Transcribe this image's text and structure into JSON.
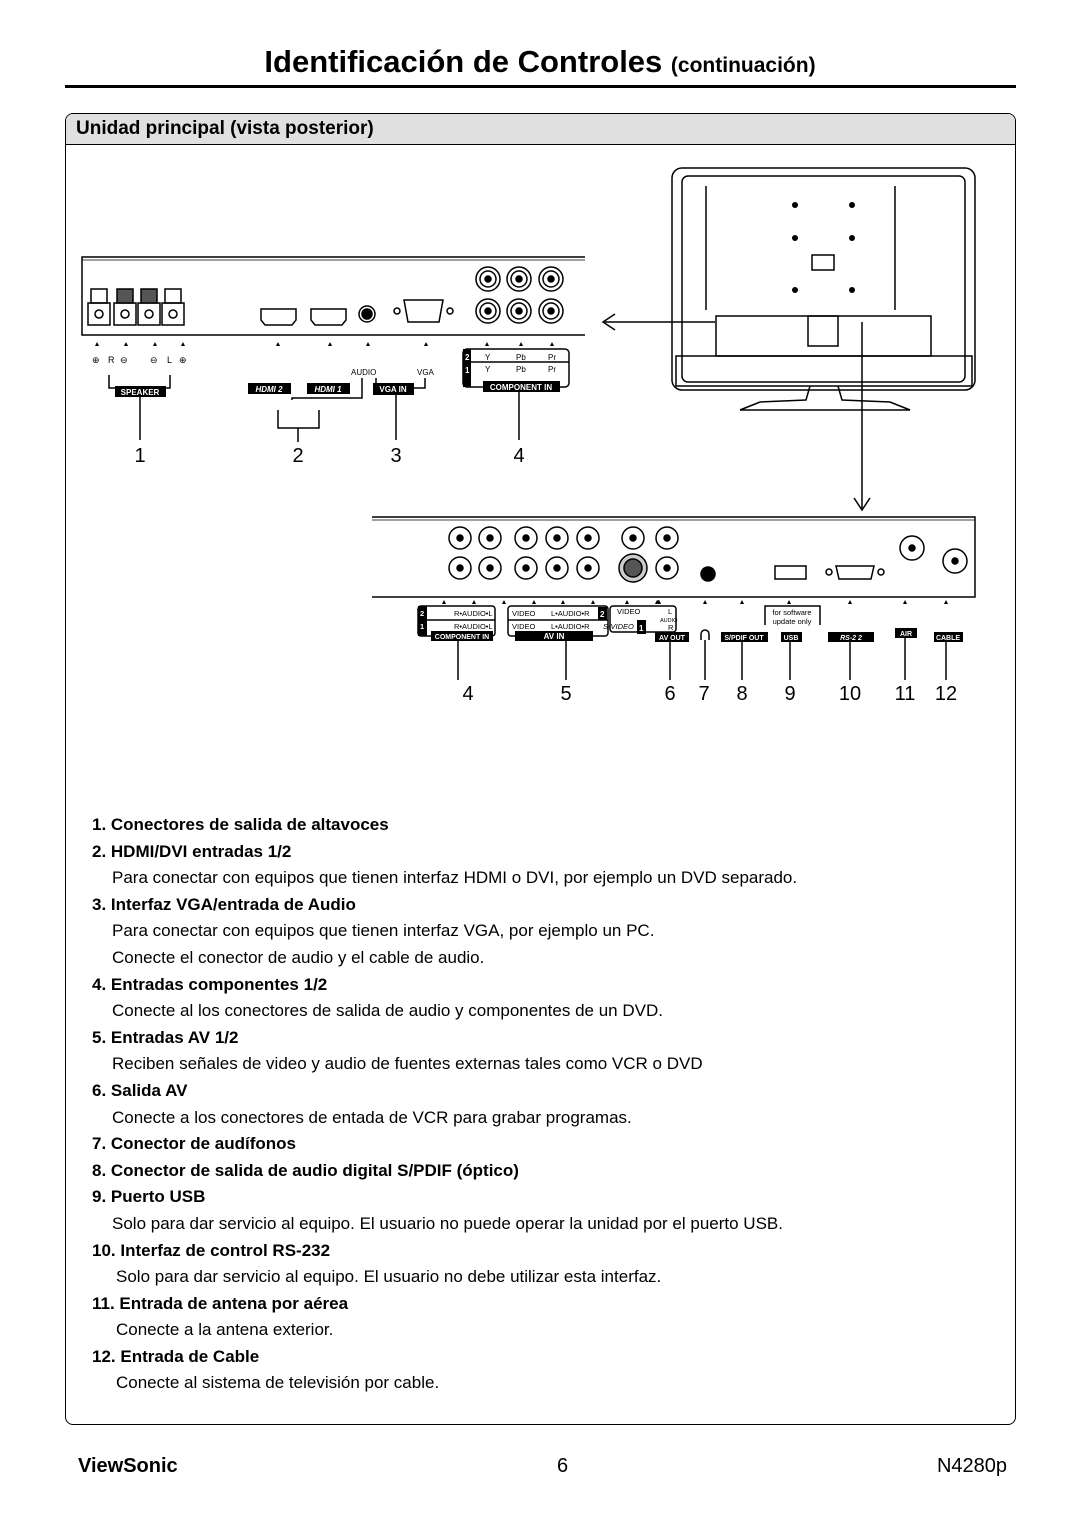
{
  "title": {
    "main": "Identificación de Controles",
    "sub": "(continuación)"
  },
  "section": {
    "heading": "Unidad principal (vista posterior)"
  },
  "diagram_top": {
    "speaker_marks": [
      "⊕",
      "R",
      "⊖",
      "⊖",
      "L",
      "⊕"
    ],
    "speaker_label": "SPEAKER",
    "hdmi2_label": "HDMI 2",
    "hdmi1_label": "HDMI 1",
    "audio_label": "AUDIO",
    "vga_label": "VGA",
    "vga_in_label": "VGA IN",
    "component_rows": [
      {
        "num": "2",
        "y": "Y",
        "pb": "Pb",
        "pr": "Pr"
      },
      {
        "num": "1",
        "y": "Y",
        "pb": "Pb",
        "pr": "Pr"
      }
    ],
    "component_label": "COMPONENT IN",
    "numbers": [
      "1",
      "2",
      "3",
      "4"
    ]
  },
  "diagram_bottom": {
    "component_rows": [
      {
        "num": "2",
        "text": "R•AUDIO•L"
      },
      {
        "num": "1",
        "text": "R•AUDIO•L"
      }
    ],
    "component_label": "COMPONENT IN",
    "av_rows": [
      {
        "video": "VIDEO",
        "audio": "L•AUDIO•R",
        "num": "2"
      },
      {
        "video": "VIDEO",
        "audio": "L•AUDIO•R",
        "svideo": "S-VIDEO",
        "num": "1"
      }
    ],
    "av_in_label": "AV  IN",
    "av_out_video": "VIDEO",
    "av_out_l": "L",
    "av_out_audio": "AUDIO",
    "av_out_r": "R",
    "av_out_label": "AV OUT",
    "spdif_label": "S/PDIF OUT",
    "usb_note": [
      "for software",
      "update only"
    ],
    "usb_label": "USB",
    "rs232_label": "RS-2 2",
    "air_label": "AIR",
    "cable_label": "CABLE",
    "numbers": [
      "4",
      "5",
      "6",
      "7",
      "8",
      "9",
      "10",
      "11",
      "12"
    ]
  },
  "items": [
    {
      "heading": "1. Conectores de salida de altavoces",
      "desc": []
    },
    {
      "heading": "2. HDMI/DVI entradas 1/2",
      "desc": [
        "Para conectar con equipos que tienen interfaz HDMI o DVI, por ejemplo un DVD separado."
      ]
    },
    {
      "heading": "3. Interfaz VGA/entrada de Audio",
      "desc": [
        "Para conectar con equipos que tienen interfaz VGA, por ejemplo un PC.",
        "Conecte el conector de audio y el cable de audio."
      ]
    },
    {
      "heading": "4. Entradas componentes 1/2",
      "desc": [
        "Conecte al los conectores de salida de audio y componentes de un DVD."
      ]
    },
    {
      "heading": "5. Entradas AV 1/2",
      "desc": [
        "Reciben señales de video y audio de fuentes externas tales como VCR o DVD"
      ]
    },
    {
      "heading": "6. Salida AV",
      "desc": [
        "Conecte a los conectores de entada de VCR para grabar programas."
      ]
    },
    {
      "heading": "7. Conector de audífonos",
      "desc": []
    },
    {
      "heading": "8. Conector de salida de audio digital S/PDIF (óptico)",
      "desc": []
    },
    {
      "heading": "9. Puerto USB",
      "desc": [
        "Solo para dar servicio al equipo. El usuario no puede operar la unidad por el puerto USB."
      ]
    },
    {
      "heading": "10. Interfaz de control RS-232",
      "desc": [
        "Solo para dar servicio al equipo. El usuario no debe utilizar esta interfaz."
      ]
    },
    {
      "heading": "11. Entrada de antena por aérea",
      "desc": [
        "Conecte a la antena exterior."
      ]
    },
    {
      "heading": "12. Entrada de Cable",
      "desc": [
        "Conecte al sistema de televisión por cable."
      ]
    }
  ],
  "footer": {
    "brand": "ViewSonic",
    "page": "6",
    "model": "N4280p"
  }
}
